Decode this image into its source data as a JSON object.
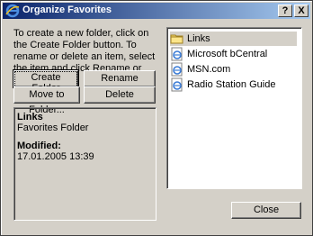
{
  "window": {
    "title": "Organize Favorites",
    "help_label": "?",
    "close_label": "X"
  },
  "instructions": "To create a new folder, click on the Create Folder button. To rename or delete an item, select the item and click Rename or Delete.",
  "buttons": {
    "create_folder": "Create Folder",
    "rename": "Rename",
    "move_to_folder": "Move to Folder...",
    "delete": "Delete",
    "close": "Close"
  },
  "info": {
    "name": "Links",
    "type": "Favorites Folder",
    "modified_label": "Modified:",
    "modified_value": "17.01.2005 13:39"
  },
  "favorites": [
    {
      "label": "Links",
      "icon": "folder-icon",
      "selected": true
    },
    {
      "label": "Microsoft bCentral",
      "icon": "internet-shortcut-icon",
      "selected": false
    },
    {
      "label": "MSN.com",
      "icon": "internet-shortcut-icon",
      "selected": false
    },
    {
      "label": "Radio Station Guide",
      "icon": "internet-shortcut-icon",
      "selected": false
    }
  ],
  "colors": {
    "title_start": "#0a246a",
    "title_end": "#a6caf0",
    "face": "#d4d0c8"
  }
}
